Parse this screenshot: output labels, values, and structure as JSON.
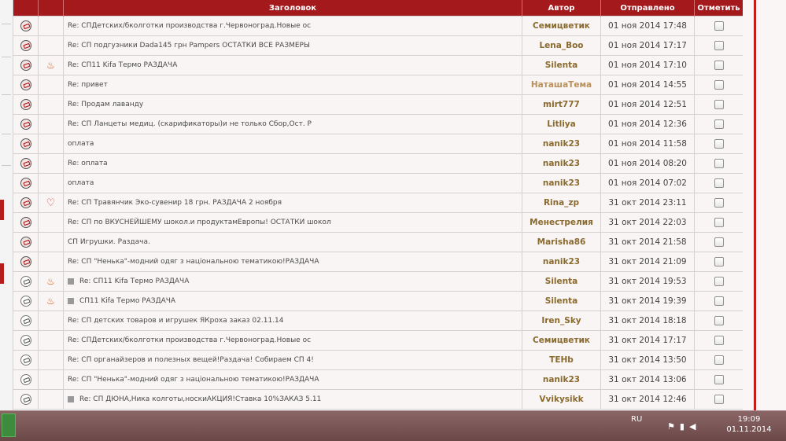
{
  "header": {
    "subject": "Заголовок",
    "author": "Автор",
    "sent": "Отправлено",
    "select": "Отметить"
  },
  "rows": [
    {
      "status": "unread",
      "marker": "",
      "subject": "Re: СПДетских/бколготки производства г.Червоноград.Новые ос",
      "author": "Семицветик",
      "date": "01 ноя 2014 17:48",
      "sticky": false
    },
    {
      "status": "unread",
      "marker": "",
      "subject": "Re: СП подгузники Dada145 грн Pampers ОСТАТКИ ВСЕ РАЗМЕРЫ",
      "author": "Lena_Boo",
      "date": "01 ноя 2014 17:17",
      "sticky": false
    },
    {
      "status": "unread",
      "marker": "fire",
      "subject": "Re: СП11 Kifa Термо РАЗДАЧА",
      "author": "Silenta",
      "date": "01 ноя 2014 17:10",
      "sticky": false
    },
    {
      "status": "unread",
      "marker": "",
      "subject": "Re: привет",
      "author": "НаташаТема",
      "date": "01 ноя 2014 14:55",
      "sticky": false,
      "light": true
    },
    {
      "status": "unread",
      "marker": "",
      "subject": "Re: Продам лаванду",
      "author": "mirt777",
      "date": "01 ноя 2014 12:51",
      "sticky": false
    },
    {
      "status": "unread",
      "marker": "",
      "subject": "Re: СП Ланцеты медиц. (скарификаторы)и не только Сбор,Ост. Р",
      "author": "Litliya",
      "date": "01 ноя 2014 12:36",
      "sticky": false
    },
    {
      "status": "unread",
      "marker": "",
      "subject": "оплата",
      "author": "nanik23",
      "date": "01 ноя 2014 11:58",
      "sticky": false
    },
    {
      "status": "unread",
      "marker": "",
      "subject": "Re: оплата",
      "author": "nanik23",
      "date": "01 ноя 2014 08:20",
      "sticky": false
    },
    {
      "status": "unread",
      "marker": "",
      "subject": "оплата",
      "author": "nanik23",
      "date": "01 ноя 2014 07:02",
      "sticky": false
    },
    {
      "status": "unread",
      "marker": "heart",
      "subject": "Re: СП Травянчик Эко-сувенир 18 грн. РАЗДАЧА 2 ноября",
      "author": "Rina_zp",
      "date": "31 окт 2014 23:11",
      "sticky": false
    },
    {
      "status": "unread",
      "marker": "",
      "subject": "Re: СП по ВКУСНЕЙШЕМУ шокол.и продуктамЕвропы! ОСТАТКИ шокол",
      "author": "Менестрелия",
      "date": "31 окт 2014 22:03",
      "sticky": false
    },
    {
      "status": "unread",
      "marker": "",
      "subject": "СП Игрушки. Раздача.",
      "author": "Marisha86",
      "date": "31 окт 2014 21:58",
      "sticky": false
    },
    {
      "status": "unread",
      "marker": "",
      "subject": "Re: СП \"Ненька\"-модний одяг з національною тематикою!РАЗДАЧА",
      "author": "nanik23",
      "date": "31 окт 2014 21:09",
      "sticky": false
    },
    {
      "status": "read",
      "marker": "fire",
      "subject": "Re: СП11 Kifa Термо РАЗДАЧА",
      "author": "Silenta",
      "date": "31 окт 2014 19:53",
      "sticky": true
    },
    {
      "status": "read",
      "marker": "fire",
      "subject": "СП11 Kifa Термо РАЗДАЧА",
      "author": "Silenta",
      "date": "31 окт 2014 19:39",
      "sticky": true
    },
    {
      "status": "read",
      "marker": "",
      "subject": "Re: СП детских товаров и игрушек ЯКроха заказ 02.11.14",
      "author": "Iren_Sky",
      "date": "31 окт 2014 18:18",
      "sticky": false
    },
    {
      "status": "read",
      "marker": "",
      "subject": "Re: СПДетских/бколготки производства г.Червоноград.Новые ос",
      "author": "Семицветик",
      "date": "31 окт 2014 17:17",
      "sticky": false
    },
    {
      "status": "read",
      "marker": "",
      "subject": "Re: СП органайзеров и полезных вещей!Раздача! Собираем СП 4!",
      "author": "TEHb",
      "date": "31 окт 2014 13:50",
      "sticky": false
    },
    {
      "status": "read",
      "marker": "",
      "subject": "Re: СП \"Ненька\"-модний одяг з національною тематикою!РАЗДАЧА",
      "author": "nanik23",
      "date": "31 окт 2014 13:06",
      "sticky": false
    },
    {
      "status": "read",
      "marker": "",
      "subject": "Re: СП ДЮНА,Ника колготы,носкиАКЦИЯ!Ставка 10%ЗАКАЗ 5.11",
      "author": "Vvikysikk",
      "date": "31 окт 2014 12:46",
      "sticky": true
    }
  ],
  "taskbar": {
    "lang": "RU",
    "time": "19:09",
    "date": "01.11.2014"
  }
}
